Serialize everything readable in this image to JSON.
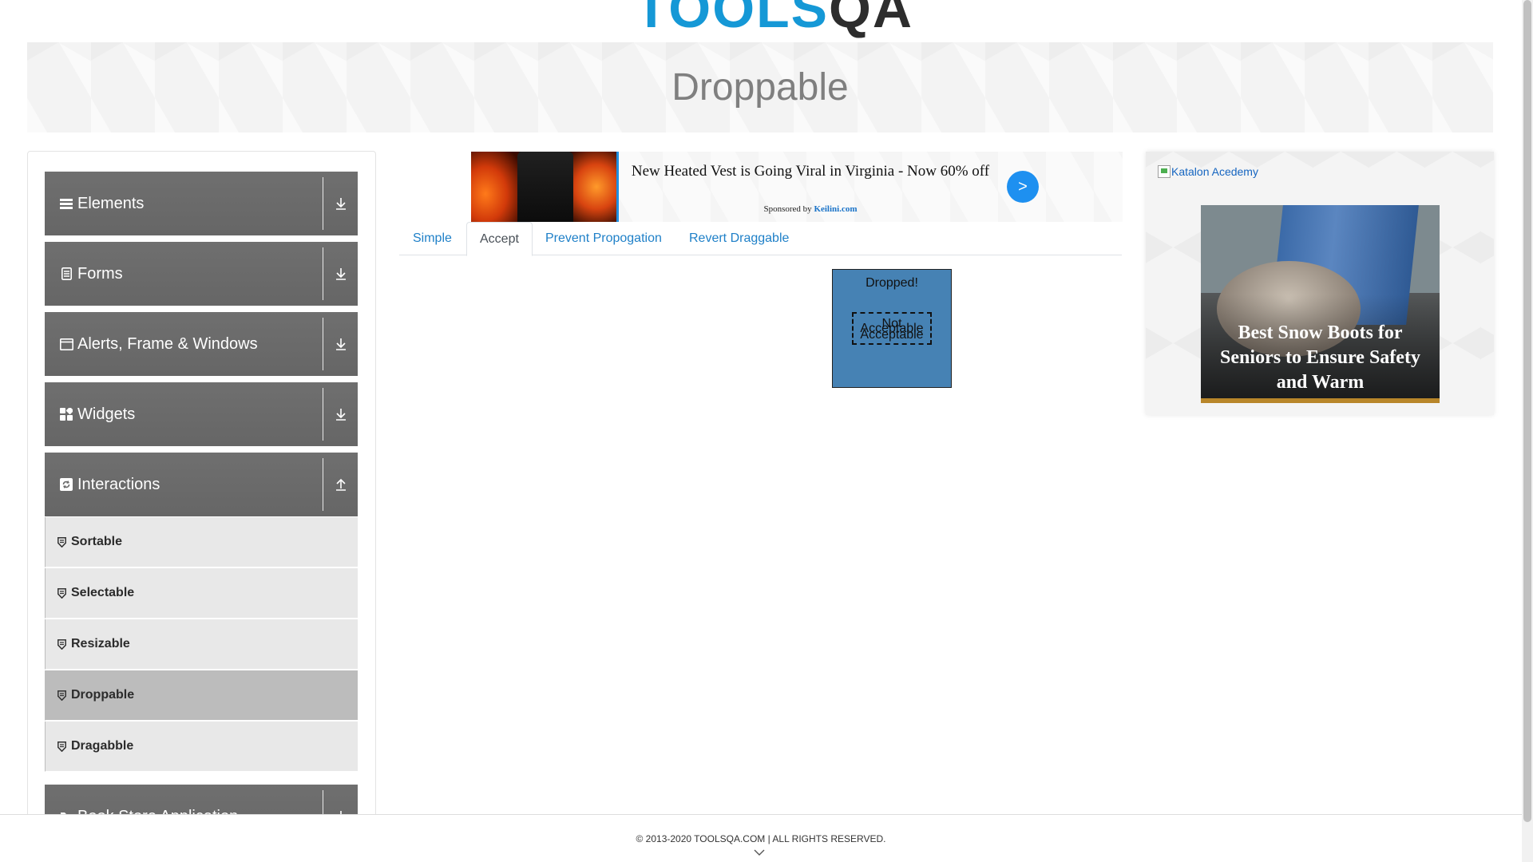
{
  "header": {
    "logo_main": "TOOLS",
    "logo_accent": "QA"
  },
  "page_title": "Droppable",
  "sidebar": {
    "groups": [
      {
        "label": "Elements",
        "icon": "menu-icon",
        "expanded": false
      },
      {
        "label": "Forms",
        "icon": "document-icon",
        "expanded": false
      },
      {
        "label": "Alerts, Frame & Windows",
        "icon": "window-icon",
        "expanded": false
      },
      {
        "label": "Widgets",
        "icon": "grid-icon",
        "expanded": false
      },
      {
        "label": "Interactions",
        "icon": "refresh-icon",
        "expanded": true
      },
      {
        "label": "Book Store Application",
        "icon": "book-icon",
        "expanded": false
      }
    ],
    "items": [
      {
        "label": "Sortable",
        "active": false
      },
      {
        "label": "Selectable",
        "active": false
      },
      {
        "label": "Resizable",
        "active": false
      },
      {
        "label": "Droppable",
        "active": true
      },
      {
        "label": "Dragabble",
        "active": false
      }
    ]
  },
  "ad": {
    "title": "New Heated Vest is Going Viral in Virginia - Now 60% off",
    "sponsored_prefix": "Sponsored by",
    "sponsor": "Keilini.com",
    "next_label": ">"
  },
  "tabs": [
    {
      "label": "Simple",
      "active": false
    },
    {
      "label": "Accept",
      "active": true
    },
    {
      "label": "Prevent Propogation",
      "active": false
    },
    {
      "label": "Revert Draggable",
      "active": false
    }
  ],
  "droppable": {
    "drop_text": "Dropped!",
    "drag_not_acceptable": "Not Acceptable",
    "drag_acceptable": "Acceptable"
  },
  "right_ad": {
    "link_text": "Katalon Acedemy",
    "caption": "Best Snow Boots for Seniors to Ensure Safety and Warm"
  },
  "footer": {
    "text": "© 2013-2020 TOOLSQA.COM | ALL RIGHTS RESERVED."
  },
  "colors": {
    "accent": "#1f80c8",
    "drop_zone": "#4682b4",
    "sidebar_group": "#6b6b6b"
  }
}
